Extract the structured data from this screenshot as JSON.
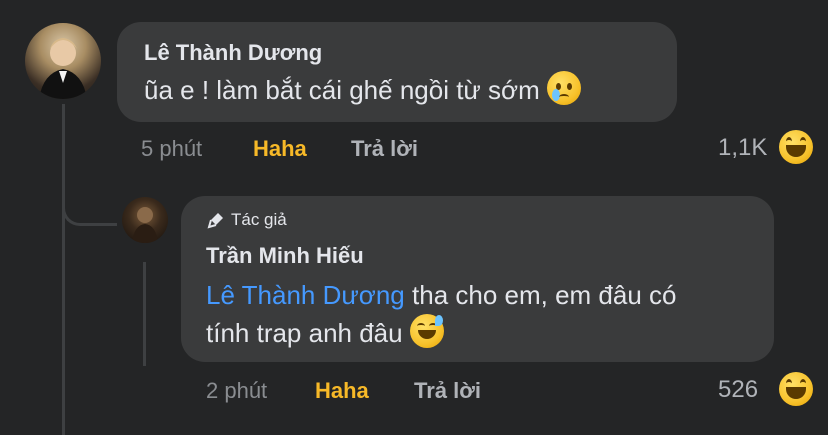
{
  "comment": {
    "author": "Lê Thành Dương",
    "text": "ũa e ! làm bắt cái ghế ngồi từ sớm",
    "emoji": "crying-face-icon",
    "time": "5 phút",
    "reaction_label": "Haha",
    "reply_label": "Trả lời",
    "reaction_count": "1,1K",
    "reaction_icon": "laughing-face-icon"
  },
  "reply": {
    "badge": "Tác giả",
    "author": "Trần Minh Hiếu",
    "mention": "Lê Thành Dương",
    "text_line1": " tha cho em, em đâu có",
    "text_line2": "tính trap anh đâu",
    "emoji": "sweat-smile-icon",
    "time": "2 phút",
    "reaction_label": "Haha",
    "reply_label": "Trả lời",
    "reaction_count": "526",
    "reaction_icon": "laughing-face-icon"
  },
  "colors": {
    "background": "#242526",
    "bubble": "#3a3b3c",
    "mention": "#4599ff",
    "haha": "#f7b928"
  }
}
